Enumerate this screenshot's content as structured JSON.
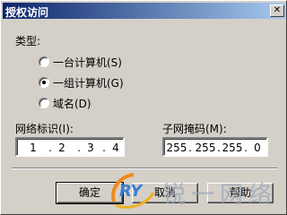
{
  "window": {
    "title": "授权访问",
    "close_glyph": "✕"
  },
  "type_label": "类型:",
  "radios": [
    {
      "label": "一台计算机(S)",
      "checked": false
    },
    {
      "label": "一组计算机(G)",
      "checked": true
    },
    {
      "label": "域名(D)",
      "checked": false
    }
  ],
  "network_id": {
    "label": "网络标识(I):",
    "octets": [
      "1",
      "2",
      "3",
      "4"
    ]
  },
  "subnet_mask": {
    "label": "子网掩码(M):",
    "octets": [
      "255",
      "255",
      "255",
      "0"
    ]
  },
  "buttons": {
    "ok": "确定",
    "cancel": "取消",
    "help": "帮助"
  },
  "watermark": {
    "logo_text": "RY",
    "text": "锐一网络"
  }
}
